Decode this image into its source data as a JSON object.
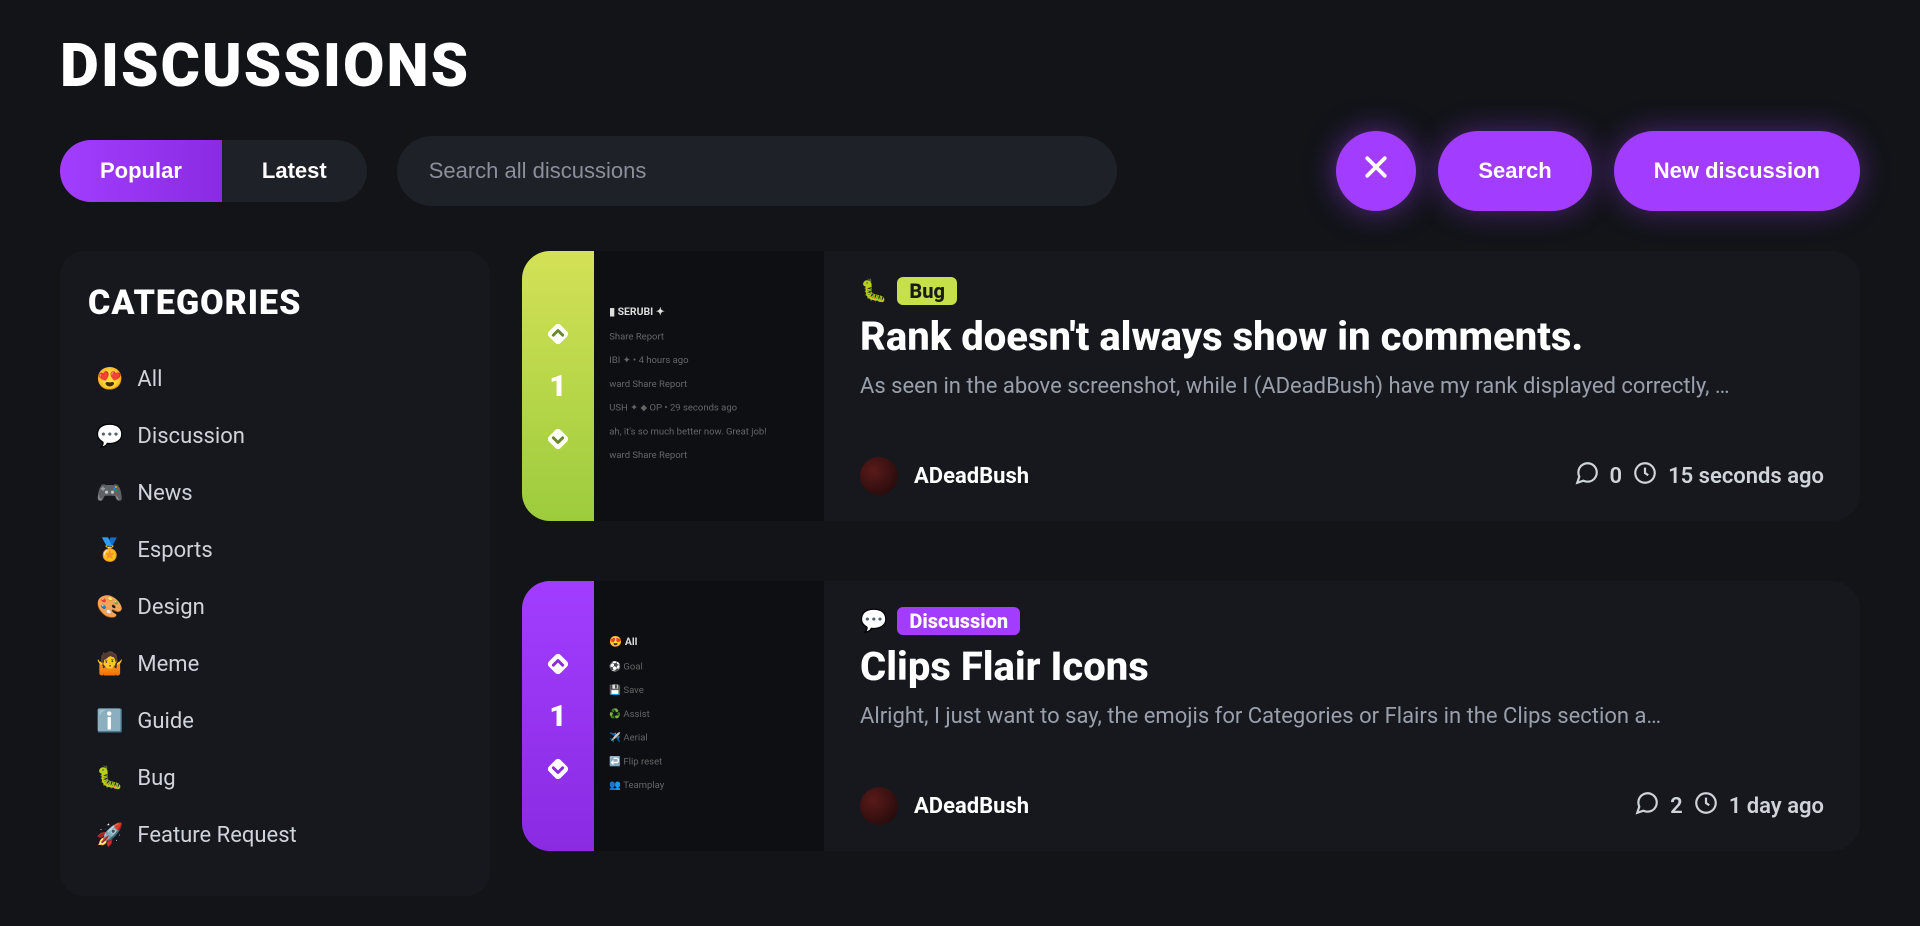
{
  "pageTitle": "DISCUSSIONS",
  "tabs": {
    "popular": "Popular",
    "latest": "Latest"
  },
  "search": {
    "placeholder": "Search all discussions"
  },
  "buttons": {
    "search": "Search",
    "newDiscussion": "New discussion"
  },
  "sidebar": {
    "title": "CATEGORIES",
    "items": [
      {
        "emoji": "😍",
        "label": "All"
      },
      {
        "emoji": "💬",
        "label": "Discussion"
      },
      {
        "emoji": "🎮",
        "label": "News"
      },
      {
        "emoji": "🏅",
        "label": "Esports"
      },
      {
        "emoji": "🎨",
        "label": "Design"
      },
      {
        "emoji": "🤷",
        "label": "Meme"
      },
      {
        "emoji": "ℹ️",
        "label": "Guide"
      },
      {
        "emoji": "🐛",
        "label": "Bug"
      },
      {
        "emoji": "🚀",
        "label": "Feature Request"
      }
    ]
  },
  "posts": [
    {
      "votes": "1",
      "category": "bug",
      "tagEmoji": "🐛",
      "tagLabel": "Bug",
      "title": "Rank doesn't always show in comments.",
      "excerpt": "As seen in the above screenshot, while I (ADeadBush) have my rank displayed correctly, …",
      "author": "ADeadBush",
      "comments": "0",
      "time": "15 seconds ago"
    },
    {
      "votes": "1",
      "category": "discussion",
      "tagEmoji": "💬",
      "tagLabel": "Discussion",
      "title": "Clips Flair Icons",
      "excerpt": "Alright, I just want to say, the emojis for Categories or Flairs in the Clips section a…",
      "author": "ADeadBush",
      "comments": "2",
      "time": "1 day ago"
    }
  ],
  "thumbs": {
    "0": [
      "▮ SERUBI ✦",
      "Share  Report",
      "IBI ✦ • 4 hours ago",
      "ward  Share  Report",
      "USH ✦ ⬥ OP • 29 seconds ago",
      "ah, it's so much better now. Great job!",
      "ward  Share  Report"
    ],
    "1": [
      "😍 All",
      "⚽ Goal",
      "💾 Save",
      "♻️ Assist",
      "✈️ Aerial",
      "↩️ Flip reset",
      "👥 Teamplay"
    ]
  }
}
